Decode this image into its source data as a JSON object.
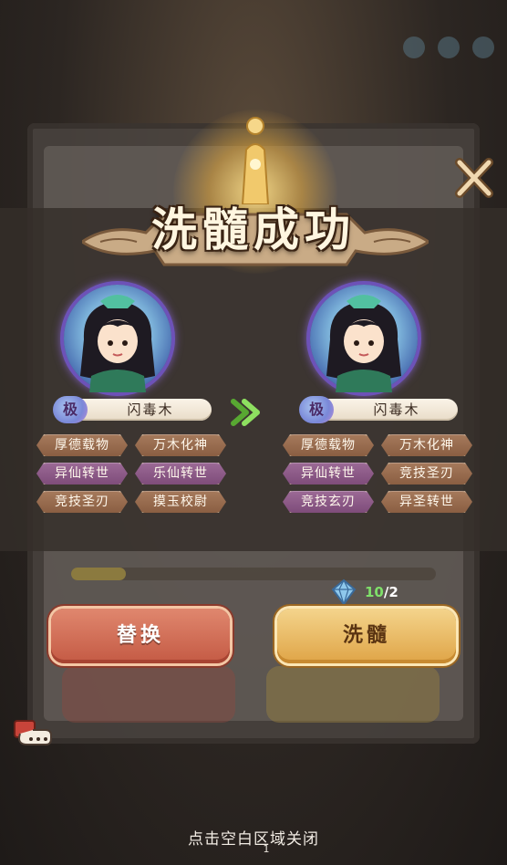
{
  "title": "洗髓成功",
  "close_icon": "close-x-icon",
  "arrow_icon": "green-chevron-right-icon",
  "hero_before": {
    "grade": "极",
    "name": "闪毒木",
    "skills": [
      {
        "label": "厚德载物",
        "tone": "brown"
      },
      {
        "label": "万木化神",
        "tone": "brown"
      },
      {
        "label": "异仙转世",
        "tone": "purple"
      },
      {
        "label": "乐仙转世",
        "tone": "purple"
      },
      {
        "label": "竞技圣刃",
        "tone": "brown"
      },
      {
        "label": "摸玉校尉",
        "tone": "brown"
      }
    ]
  },
  "hero_after": {
    "grade": "极",
    "name": "闪毒木",
    "skills": [
      {
        "label": "厚德载物",
        "tone": "brown"
      },
      {
        "label": "万木化神",
        "tone": "brown"
      },
      {
        "label": "异仙转世",
        "tone": "purple"
      },
      {
        "label": "竞技圣刃",
        "tone": "brown"
      },
      {
        "label": "竞技玄刃",
        "tone": "purple"
      },
      {
        "label": "异圣转世",
        "tone": "brown"
      }
    ]
  },
  "cost": {
    "have": "10",
    "separator": "/",
    "need": "2",
    "icon": "blue-gem-icon"
  },
  "buttons": {
    "replace": "替换",
    "wash": "洗髓"
  },
  "hint": "点击空白区域关闭",
  "page_number": "1",
  "colors": {
    "accent_green": "#7fe06a",
    "replace_button": "#c45a44",
    "wash_button": "#dfa446",
    "title": "#fff6e0"
  }
}
